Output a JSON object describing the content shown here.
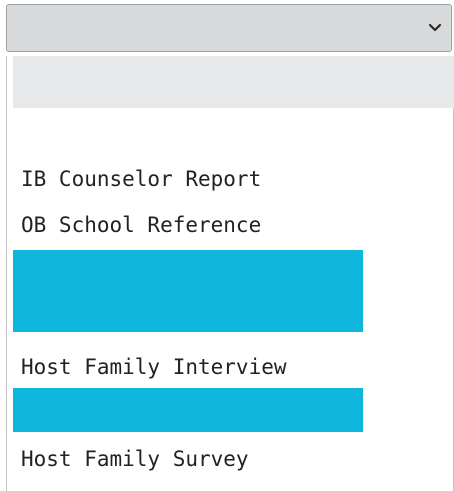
{
  "select": {
    "value": "",
    "icon": "chevron-down-icon"
  },
  "options": [
    {
      "label": ""
    },
    {
      "label": ""
    },
    {
      "label": "IB Counselor Report"
    },
    {
      "label": "OB School Reference"
    },
    {
      "label": ""
    },
    {
      "label": "Host Family Interview"
    },
    {
      "label": ""
    },
    {
      "label": "Host Family Survey"
    }
  ],
  "colors": {
    "select_background": "#d8d9db",
    "highlight": "#0fb6dc",
    "blank_option": "#e7e8ea"
  }
}
